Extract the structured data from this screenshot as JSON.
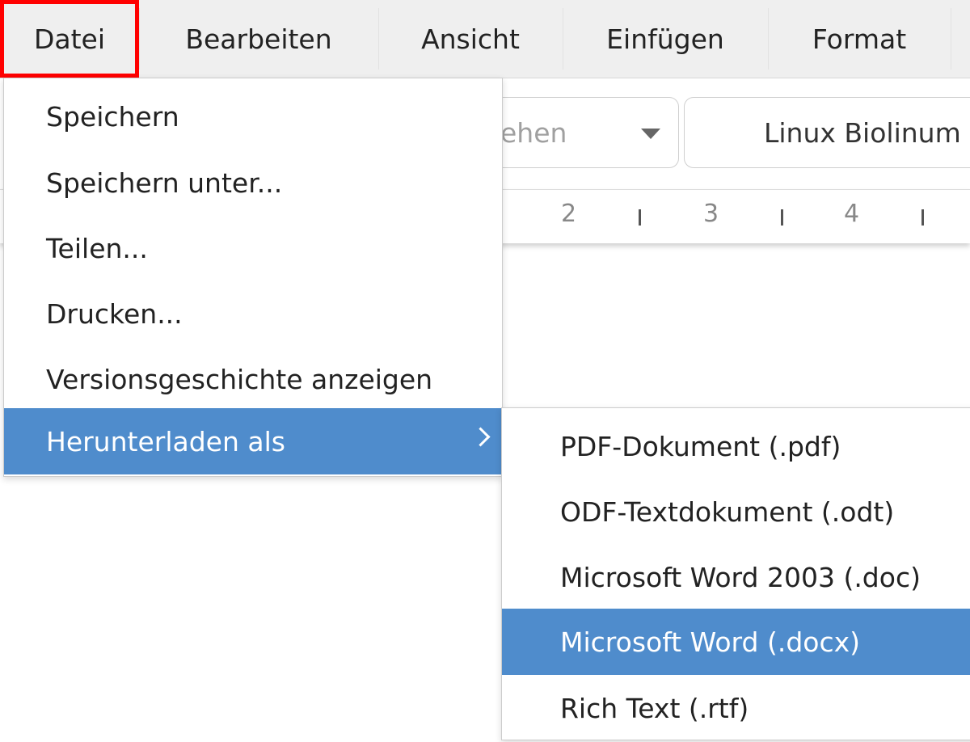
{
  "menubar": {
    "items": [
      {
        "label": "Datei"
      },
      {
        "label": "Bearbeiten"
      },
      {
        "label": "Ansicht"
      },
      {
        "label": "Einfügen"
      },
      {
        "label": "Format"
      }
    ]
  },
  "toolbar": {
    "paragraph_style_partial": "ehen",
    "font_name": "Linux Biolinum"
  },
  "ruler": {
    "numbers": [
      "2",
      "3",
      "4"
    ]
  },
  "file_menu": {
    "items": [
      {
        "label": "Speichern"
      },
      {
        "label": "Speichern unter..."
      },
      {
        "label": "Teilen..."
      },
      {
        "label": "Drucken..."
      },
      {
        "label": "Versionsgeschichte anzeigen"
      },
      {
        "label": "Herunterladen als",
        "has_submenu": true,
        "active": true
      }
    ]
  },
  "download_submenu": {
    "items": [
      {
        "label": "PDF-Dokument (.pdf)"
      },
      {
        "label": "ODF-Textdokument (.odt)"
      },
      {
        "label": "Microsoft Word 2003 (.doc)"
      },
      {
        "label": "Microsoft Word (.docx)",
        "active": true
      },
      {
        "label": "Rich Text (.rtf)"
      }
    ]
  },
  "colors": {
    "highlight": "#4f8ccc",
    "annotation": "#ff0000",
    "menubar_bg": "#efefef"
  },
  "icons": {
    "submenu_arrow": "chevron-right-icon",
    "dropdown_caret": "caret-down-icon"
  }
}
